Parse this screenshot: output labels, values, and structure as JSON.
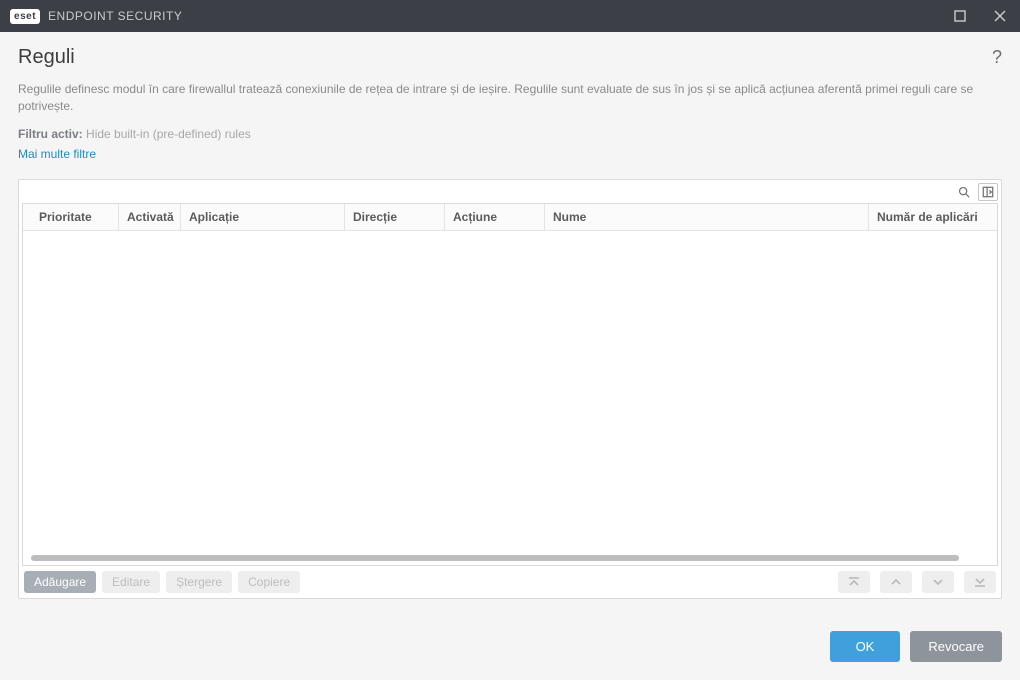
{
  "titlebar": {
    "brand": "eset",
    "product": "ENDPOINT SECURITY"
  },
  "page": {
    "title": "Reguli",
    "help_glyph": "?",
    "description": "Regulile definesc modul în care firewallul tratează conexiunile de rețea de intrare și de ieșire. Regulile sunt evaluate de sus în jos și se aplică acțiunea aferentă primei reguli care se potrivește.",
    "filter_label": "Filtru activ:",
    "filter_value": "Hide built-in (pre-defined) rules",
    "more_filters": "Mai multe filtre"
  },
  "table": {
    "headers": {
      "priority": "Prioritate",
      "enabled": "Activată",
      "application": "Aplicație",
      "direction": "Direcție",
      "action": "Acțiune",
      "name": "Nume",
      "apply_count": "Număr de aplicări"
    },
    "rows": []
  },
  "panel_actions": {
    "add": "Adăugare",
    "edit": "Editare",
    "delete": "Ștergere",
    "copy": "Copiere"
  },
  "footer": {
    "ok": "OK",
    "cancel": "Revocare"
  }
}
